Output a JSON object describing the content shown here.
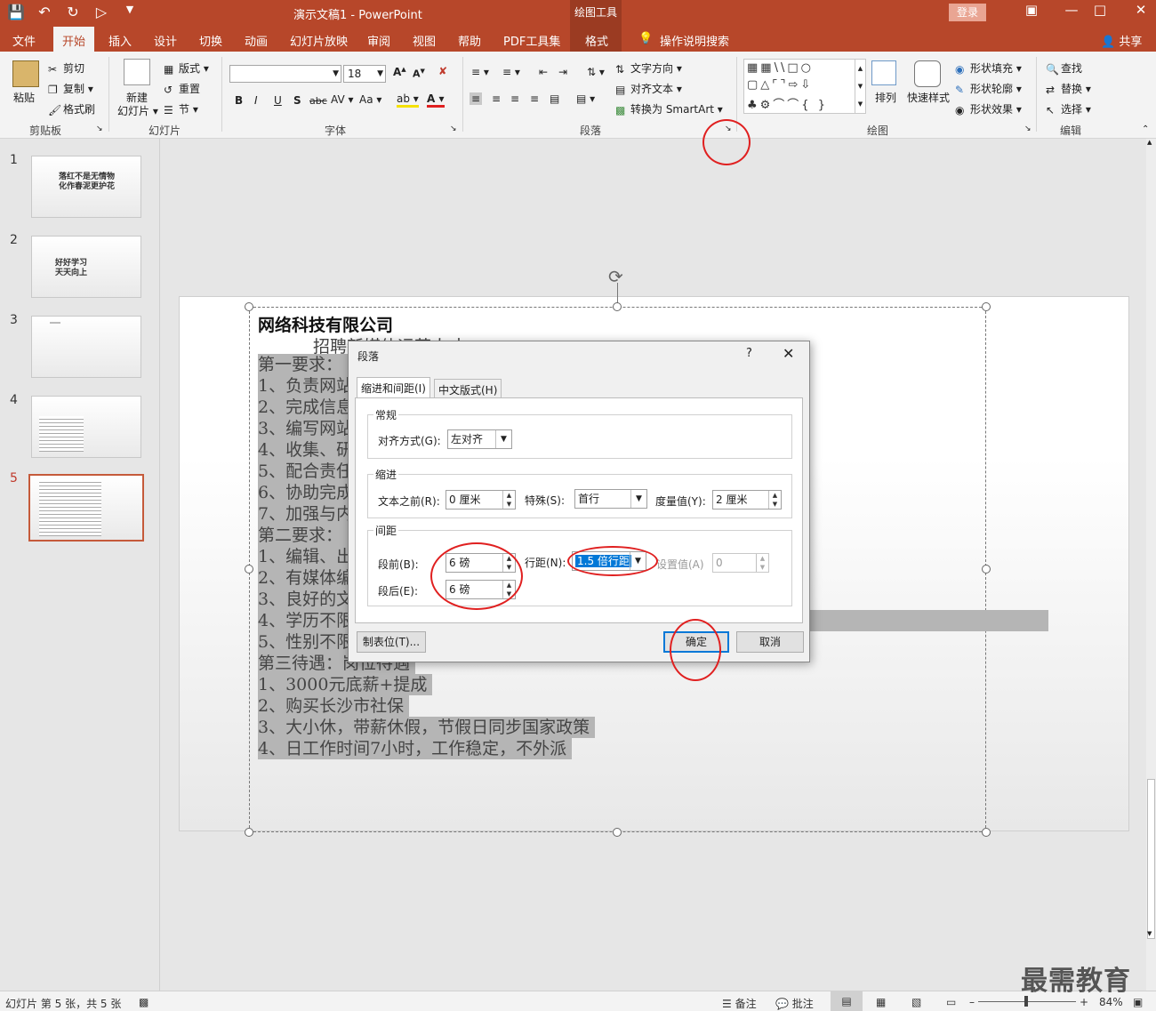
{
  "titlebar": {
    "doc_title": "演示文稿1  -  PowerPoint",
    "tool_context": "绘图工具",
    "login": "登录",
    "share": "共享"
  },
  "tabs": [
    "文件",
    "开始",
    "插入",
    "设计",
    "切换",
    "动画",
    "幻灯片放映",
    "审阅",
    "视图",
    "帮助",
    "PDF工具集",
    "格式"
  ],
  "search_hint": "操作说明搜索",
  "ribbon": {
    "clipboard": {
      "paste": "粘贴",
      "cut": "剪切",
      "copy": "复制",
      "format_painter": "格式刷",
      "label": "剪贴板"
    },
    "slides": {
      "new_slide": "新建",
      "new_slide2": "幻灯片",
      "layout": "版式",
      "reset": "重置",
      "section": "节",
      "label": "幻灯片"
    },
    "font": {
      "font_size": "18",
      "label": "字体"
    },
    "paragraph": {
      "text_direction": "文字方向",
      "align_text": "对齐文本",
      "smartart": "转换为 SmartArt",
      "label": "段落"
    },
    "drawing": {
      "arrange": "排列",
      "quick_styles": "快速样式",
      "fill": "形状填充",
      "outline": "形状轮廓",
      "effects": "形状效果",
      "label": "绘图"
    },
    "editing": {
      "find": "查找",
      "replace": "替换",
      "select": "选择",
      "label": "编辑"
    }
  },
  "thumbnails": [
    {
      "num": "1",
      "text": "落红不是无情物\n化作春泥更护花"
    },
    {
      "num": "2",
      "text": "好好学习\n天天向上"
    },
    {
      "num": "3",
      "text": ""
    },
    {
      "num": "4",
      "text": ""
    },
    {
      "num": "5",
      "text": ""
    }
  ],
  "slide": {
    "title": "网络科技有限公司",
    "subtitle": "招聘新媒体运营人才",
    "lines": [
      "第一要求：",
      "1、负责网站",
      "2、完成信息",
      "3、编写网站",
      "4、收集、研",
      "5、配合责任",
      "6、协助完成",
      "7、加强与内",
      "第二要求：",
      "1、编辑、出",
      "2、有媒体编",
      "3、良好的文",
      "4、学历不限",
      "5、性别不限",
      "第三待遇：岗位待遇",
      "1、3000元底薪+提成",
      "2、购买长沙市社保",
      "3、大小休，带薪休假，节假日同步国家政策",
      "4、日工作时间7小时，工作稳定，不外派"
    ]
  },
  "dialog": {
    "title": "段落",
    "help": "?",
    "tab_indent": "缩进和间距(I)",
    "tab_chinese": "中文版式(H)",
    "general": {
      "legend": "常规",
      "align_label": "对齐方式(G):",
      "align_value": "左对齐"
    },
    "indent": {
      "legend": "缩进",
      "before_label": "文本之前(R):",
      "before_value": "0 厘米",
      "special_label": "特殊(S):",
      "special_value": "首行",
      "by_label": "度量值(Y):",
      "by_value": "2 厘米"
    },
    "spacing": {
      "legend": "间距",
      "before_label": "段前(B):",
      "before_value": "6 磅",
      "after_label": "段后(E):",
      "after_value": "6 磅",
      "line_label": "行距(N):",
      "line_value": "1.5 倍行距",
      "at_label": "设置值(A)",
      "at_value": "0"
    },
    "tabs_button": "制表位(T)...",
    "ok": "确定",
    "cancel": "取消"
  },
  "statusbar": {
    "slide_info": "幻灯片 第 5 张，共 5 张",
    "notes": "备注",
    "comments": "批注",
    "zoom": "84%"
  },
  "watermark": "最需教育"
}
